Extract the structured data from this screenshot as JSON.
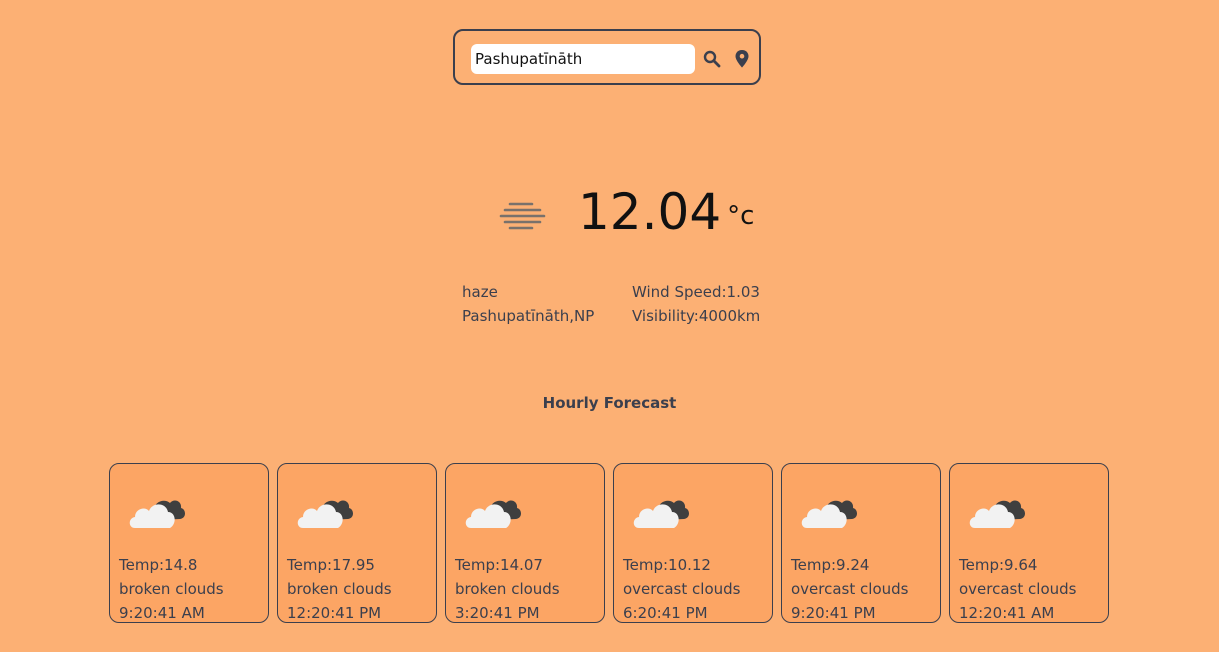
{
  "search": {
    "value": "Pashupatīnāth",
    "search_icon": "search-icon",
    "location_icon": "location-pin-icon"
  },
  "current": {
    "icon": "haze-icon",
    "temperature": "12.04",
    "unit": "°c",
    "description": "haze",
    "location": "Pashupatīnāth,NP",
    "wind": "Wind Speed:1.03",
    "visibility": "Visibility:4000km"
  },
  "forecast": {
    "title": "Hourly Forecast",
    "items": [
      {
        "icon": "broken-clouds-icon",
        "temp": "Temp:14.8",
        "desc": "broken clouds",
        "time": "9:20:41 AM"
      },
      {
        "icon": "broken-clouds-icon",
        "temp": "Temp:17.95",
        "desc": "broken clouds",
        "time": "12:20:41 PM"
      },
      {
        "icon": "broken-clouds-icon",
        "temp": "Temp:14.07",
        "desc": "broken clouds",
        "time": "3:20:41 PM"
      },
      {
        "icon": "overcast-clouds-icon",
        "temp": "Temp:10.12",
        "desc": "overcast clouds",
        "time": "6:20:41 PM"
      },
      {
        "icon": "overcast-clouds-icon",
        "temp": "Temp:9.24",
        "desc": "overcast clouds",
        "time": "9:20:41 PM"
      },
      {
        "icon": "overcast-clouds-icon",
        "temp": "Temp:9.64",
        "desc": "overcast clouds",
        "time": "12:20:41 AM"
      }
    ]
  },
  "colors": {
    "background": "#fcb074",
    "card_background": "#fca564",
    "border": "#3b3f4d"
  }
}
